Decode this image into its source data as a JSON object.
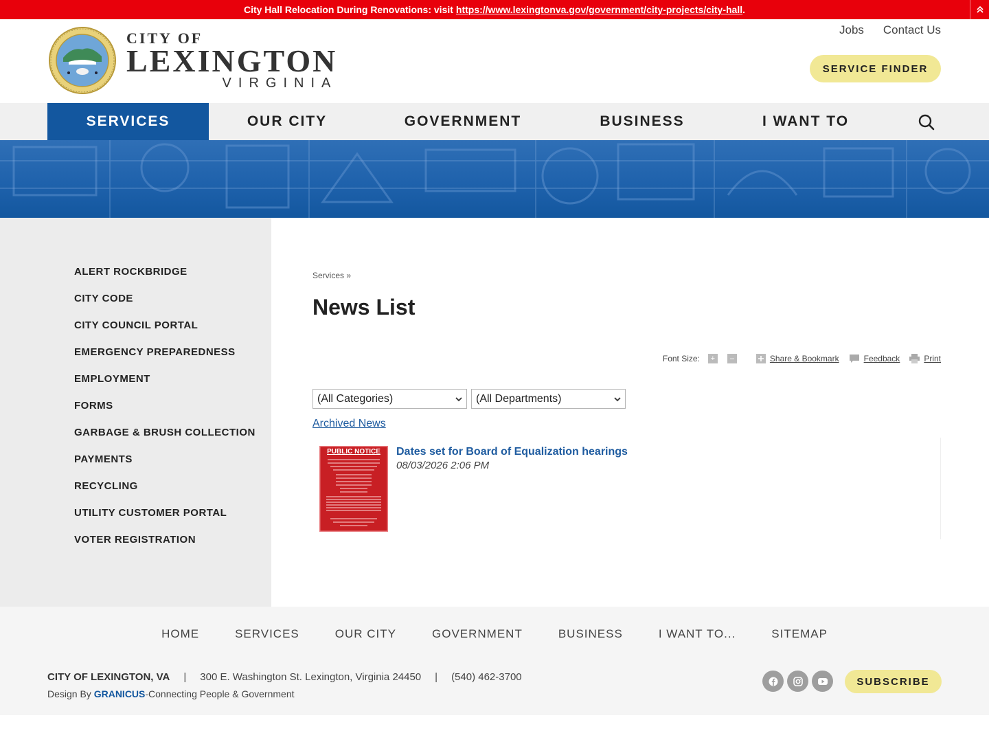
{
  "alert": {
    "text": "City Hall Relocation During Renovations: visit",
    "link": "https://www.lexingtonva.gov/government/city-projects/city-hall",
    "link_suffix": "."
  },
  "logo": {
    "top": "CITY OF",
    "main": "LEXINGTON",
    "sub": "VIRGINIA"
  },
  "header": {
    "links": [
      "Jobs",
      "Contact Us"
    ],
    "service_finder": "SERVICE FINDER"
  },
  "nav": {
    "items": [
      "SERVICES",
      "OUR CITY",
      "GOVERNMENT",
      "BUSINESS",
      "I WANT TO"
    ],
    "active": "SERVICES"
  },
  "sidebar": {
    "items": [
      "ALERT ROCKBRIDGE",
      "CITY CODE",
      "CITY COUNCIL PORTAL",
      "EMERGENCY PREPAREDNESS",
      "EMPLOYMENT",
      "FORMS",
      "GARBAGE & BRUSH COLLECTION",
      "PAYMENTS",
      "RECYCLING",
      "UTILITY CUSTOMER PORTAL",
      "VOTER REGISTRATION"
    ]
  },
  "content": {
    "breadcrumb": "Services »",
    "title": "News List",
    "tools": {
      "font_size_label": "Font Size:",
      "share": "Share & Bookmark",
      "feedback": "Feedback",
      "print": "Print"
    },
    "filters": {
      "categories": "(All Categories)",
      "departments": "(All Departments)"
    },
    "archived_link": "Archived News",
    "news": [
      {
        "thumb_title": "PUBLIC NOTICE",
        "title": "Dates set for Board of Equalization hearings",
        "date": "08/03/2026 2:06 PM"
      }
    ]
  },
  "footer": {
    "nav": [
      "HOME",
      "SERVICES",
      "OUR CITY",
      "GOVERNMENT",
      "BUSINESS",
      "I WANT TO...",
      "SITEMAP"
    ],
    "org": "CITY OF LEXINGTON, VA",
    "address": "300 E. Washington St. Lexington, Virginia 24450",
    "phone": "(540) 462-3700",
    "design_prefix": "Design By",
    "design_brand": "GRANICUS",
    "design_suffix": "-Connecting People & Government",
    "subscribe": "SUBSCRIBE",
    "socials": [
      "facebook-icon",
      "instagram-icon",
      "youtube-icon"
    ]
  },
  "colors": {
    "alert": "#e8000b",
    "primary": "#13579f",
    "accent_button": "#f1e895",
    "link": "#1f5ca0"
  }
}
